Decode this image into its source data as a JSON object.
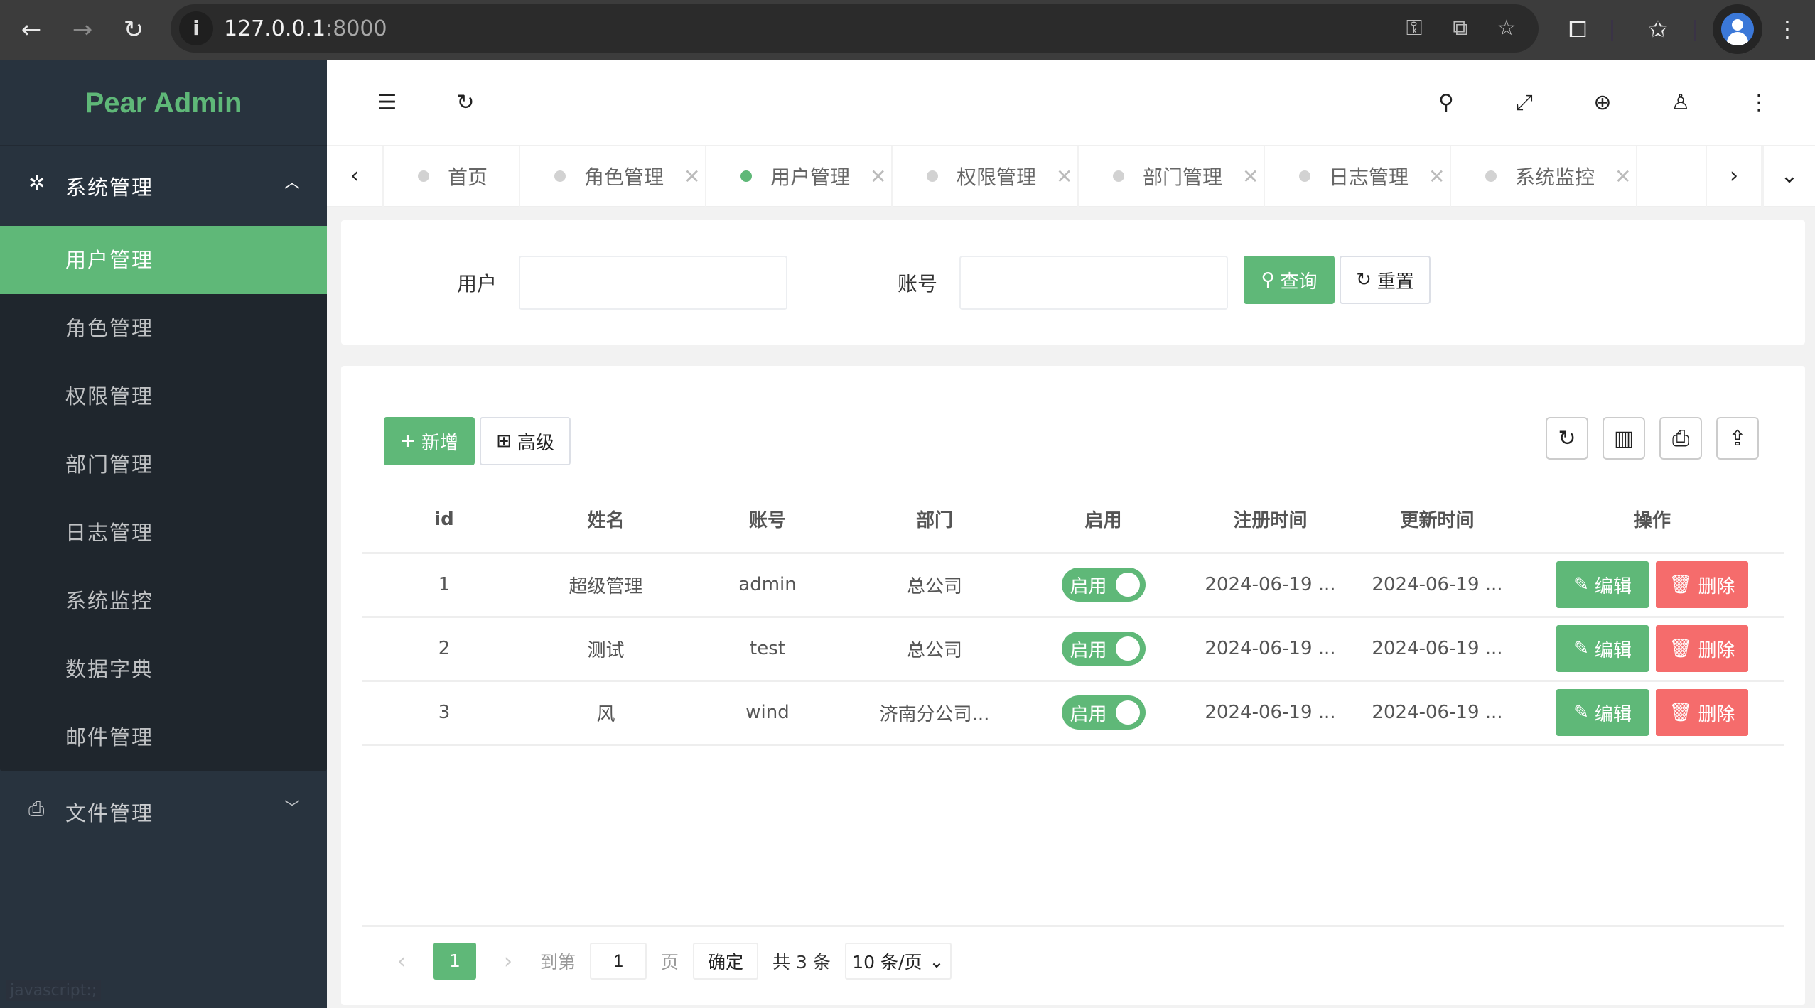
{
  "browser": {
    "url_host": "127.0.0.1",
    "url_port": ":8000",
    "icons": [
      "back-icon",
      "forward-icon",
      "reload-icon",
      "site-info-icon",
      "password-key-icon",
      "translate-icon",
      "bookmark-star-icon",
      "extensions-icon",
      "reading-list-icon",
      "profile-avatar-icon",
      "menu-kebab-icon"
    ]
  },
  "sidebar": {
    "logo": "Pear Admin",
    "groups": [
      {
        "label": "系统管理",
        "icon": "gear-icon",
        "expanded": true,
        "items": [
          {
            "label": "用户管理",
            "active": true
          },
          {
            "label": "角色管理"
          },
          {
            "label": "权限管理"
          },
          {
            "label": "部门管理"
          },
          {
            "label": "日志管理"
          },
          {
            "label": "系统监控"
          },
          {
            "label": "数据字典"
          },
          {
            "label": "邮件管理"
          }
        ]
      },
      {
        "label": "文件管理",
        "icon": "camera-icon",
        "expanded": false
      }
    ],
    "status_hint": "javascript:;"
  },
  "header": {
    "left_icons": [
      "collapse-menu-icon",
      "refresh-icon"
    ],
    "right_icons": [
      "search-icon",
      "fullscreen-icon",
      "globe-icon",
      "user-icon",
      "more-icon"
    ]
  },
  "tabs": [
    {
      "label": "首页",
      "closable": false
    },
    {
      "label": "角色管理",
      "closable": true
    },
    {
      "label": "用户管理",
      "closable": true,
      "active": true
    },
    {
      "label": "权限管理",
      "closable": true
    },
    {
      "label": "部门管理",
      "closable": true
    },
    {
      "label": "日志管理",
      "closable": true
    },
    {
      "label": "系统监控",
      "closable": true
    }
  ],
  "search": {
    "user_label": "用户",
    "user_value": "",
    "account_label": "账号",
    "account_value": "",
    "query_button": "查询",
    "reset_button": "重置"
  },
  "toolbar": {
    "add_button": "新增",
    "advanced_button": "高级",
    "right_icons": [
      "refresh-icon",
      "columns-icon",
      "print-icon",
      "export-icon"
    ]
  },
  "table": {
    "columns": [
      "id",
      "姓名",
      "账号",
      "部门",
      "启用",
      "注册时间",
      "更新时间",
      "操作"
    ],
    "rows": [
      {
        "id": "1",
        "name": "超级管理",
        "account": "admin",
        "dept": "总公司",
        "enabled": "启用",
        "created": "2024-06-19 ...",
        "updated": "2024-06-19 ..."
      },
      {
        "id": "2",
        "name": "测试",
        "account": "test",
        "dept": "总公司",
        "enabled": "启用",
        "created": "2024-06-19 ...",
        "updated": "2024-06-19 ..."
      },
      {
        "id": "3",
        "name": "风",
        "account": "wind",
        "dept": "济南分公司...",
        "enabled": "启用",
        "created": "2024-06-19 ...",
        "updated": "2024-06-19 ..."
      }
    ],
    "edit_label": "编辑",
    "delete_label": "删除"
  },
  "pagination": {
    "current_page": "1",
    "goto_label": "到第",
    "goto_value": "1",
    "page_suffix": "页",
    "confirm": "确定",
    "total": "共 3 条",
    "page_size": "10 条/页"
  },
  "colors": {
    "primary": "#5fb878",
    "danger": "#f56c6c",
    "sidebar_bg": "#28333e",
    "submenu_bg": "#1f262d"
  }
}
